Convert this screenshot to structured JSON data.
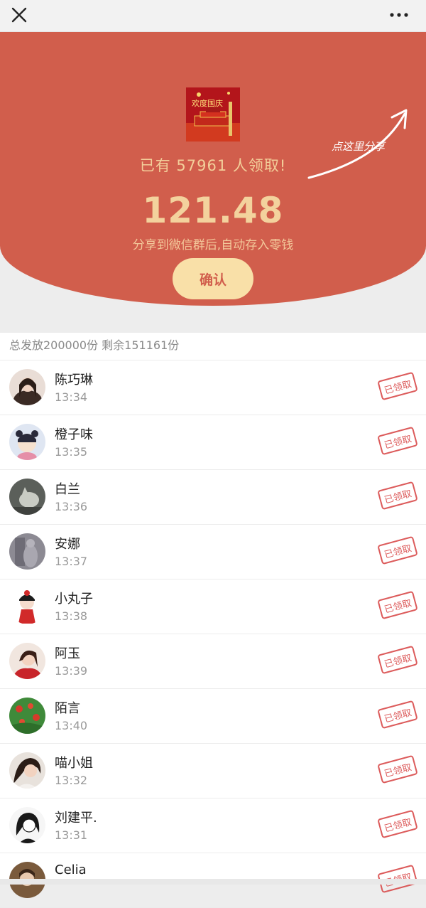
{
  "topbar": {
    "close_icon": "close-icon",
    "more_icon": "more-dots-icon"
  },
  "hero": {
    "claimed_text": "已有 57961 人领取!",
    "amount": "121.48",
    "hint": "分享到微信群后,自动存入零钱",
    "confirm_label": "确认",
    "share_hint": "点这里分享",
    "banner_text": "欢度国庆",
    "colors": {
      "background": "#d15e4c",
      "gold": "#f3d29d",
      "button": "#f9e0a8"
    }
  },
  "summary": "总发放200000份 剩余151161份",
  "records": [
    {
      "name": "陈巧琳",
      "time": "13:34",
      "status": "已领取"
    },
    {
      "name": "橙子味",
      "time": "13:35",
      "status": "已领取"
    },
    {
      "name": "白兰",
      "time": "13:36",
      "status": "已领取"
    },
    {
      "name": "安娜",
      "time": "13:37",
      "status": "已领取"
    },
    {
      "name": "小丸子",
      "time": "13:38",
      "status": "已领取"
    },
    {
      "name": "阿玉",
      "time": "13:39",
      "status": "已领取"
    },
    {
      "name": "陌言",
      "time": "13:40",
      "status": "已领取"
    },
    {
      "name": "喵小姐",
      "time": "13:32",
      "status": "已领取"
    },
    {
      "name": "刘建平.",
      "time": "13:31",
      "status": "已领取"
    },
    {
      "name": "Celia",
      "time": "",
      "status": "已领取"
    }
  ]
}
